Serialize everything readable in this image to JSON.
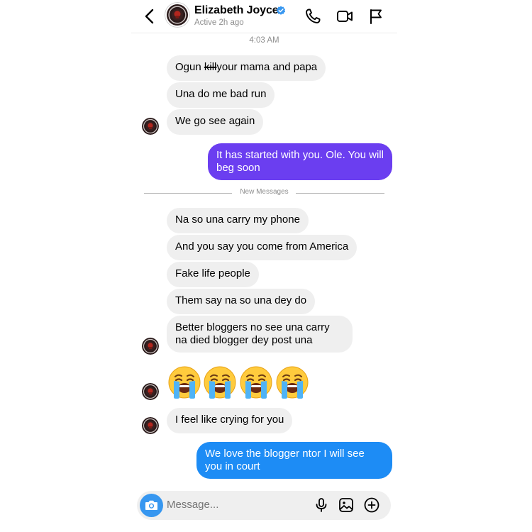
{
  "header": {
    "name": "Elizabeth Joyce",
    "status": "Active 2h ago"
  },
  "timestamp": "4:03 AM",
  "divider_label": "New Messages",
  "messages_a": {
    "m1_pre": "Ogun ",
    "m1_struck": "kill",
    "m1_post": "your mama and papa",
    "m2": "Una do me bad run",
    "m3": "We go see again",
    "out1": "It has started with you. Ole. You will beg soon"
  },
  "messages_b": {
    "m1": "Na so una carry my phone",
    "m2": "And you say you come from America",
    "m3": "Fake life people",
    "m4": "Them say na so una dey do",
    "m5": "Better bloggers no see una carry na died blogger dey post una",
    "m6": "I feel like crying for you",
    "out2": "We love the blogger ntor I will see you in court"
  },
  "emojis": [
    "crying-face",
    "crying-face",
    "crying-face",
    "crying-face"
  ],
  "input": {
    "placeholder": "Message..."
  },
  "colors": {
    "outgoing_purple": "#6b3ef0",
    "outgoing_blue": "#1d8cf5",
    "incoming_bg": "#efefef",
    "verified_blue": "#3897f0",
    "camera_blue": "#3797f0"
  },
  "icons": {
    "header": [
      "back-arrow",
      "verified-badge",
      "phone",
      "video-camera",
      "flag"
    ],
    "input": [
      "camera",
      "microphone",
      "image",
      "plus-circle"
    ]
  }
}
